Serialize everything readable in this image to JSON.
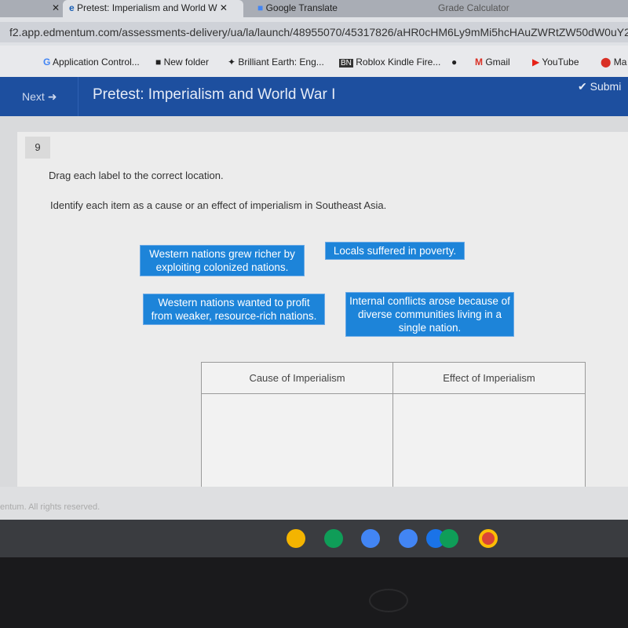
{
  "browser": {
    "tabs": [
      {
        "label": "Pretest: Imperialism and World W",
        "active": true
      },
      {
        "label": "Google Translate"
      },
      {
        "label": "Grade Calculator"
      }
    ],
    "url": "f2.app.edmentum.com/assessments-delivery/ua/la/launch/48955070/45317826/aHR0cHM6Ly9mMi5hcHAuZWRtZW50dW0uY2",
    "bookmarks": [
      "Application Control...",
      "New folder",
      "Brilliant Earth: Eng...",
      "Roblox Kindle Fire...",
      "Gmail",
      "YouTube",
      "Ma"
    ]
  },
  "header": {
    "next_label": "Next",
    "title": "Pretest: Imperialism and World War I",
    "submit_label": "Submi"
  },
  "question": {
    "number": "9",
    "instruction": "Drag each label to the correct location.",
    "prompt": "Identify each item as a cause or an effect of imperialism in Southeast Asia.",
    "labels": [
      "Western nations grew richer by exploiting colonized nations.",
      "Locals suffered in poverty.",
      "Western nations wanted to profit from weaker, resource-rich nations.",
      "Internal conflicts arose because of diverse communities living in a single nation."
    ],
    "columns": [
      "Cause of Imperialism",
      "Effect of Imperialism"
    ]
  },
  "footer": {
    "copyright": "entum. All rights reserved."
  },
  "colors": {
    "header": "#1d4f9f",
    "label": "#1d84d9"
  }
}
